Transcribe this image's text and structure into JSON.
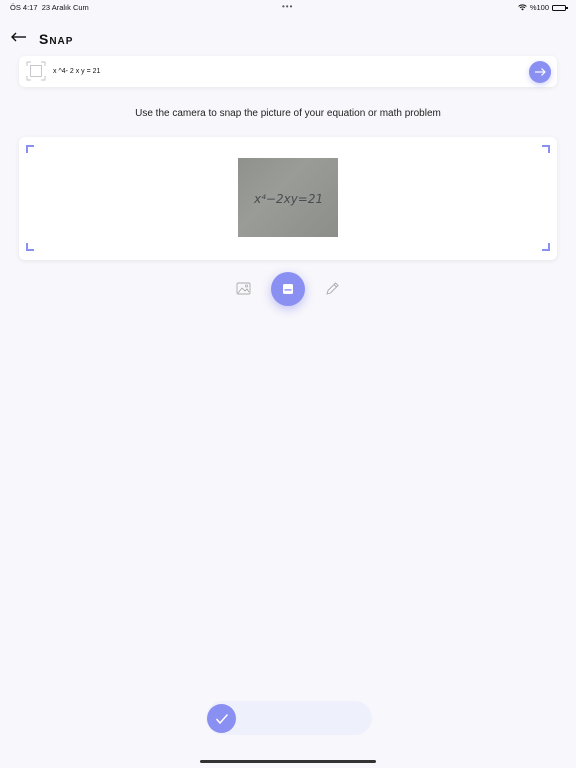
{
  "status_bar": {
    "time": "ÖS 4:17",
    "date": "23 Aralık Cum",
    "dots": "•••",
    "battery_text": "%100",
    "icons": [
      "wifi-icon",
      "battery-icon"
    ]
  },
  "header": {
    "title": "Snap",
    "back_icon": "arrow-left-icon"
  },
  "equation_bar": {
    "scan_icon": "scan-frame-icon",
    "value": "x ^4- 2 x y = 21",
    "go_icon": "arrow-right-icon"
  },
  "hint": "Use the camera to snap the picture of your equation or math problem",
  "camera_card": {
    "preview_text": "x⁴−2xy=21"
  },
  "tools": {
    "gallery_icon": "image-icon",
    "camera_icon": "camera-icon",
    "pen_icon": "pencil-icon"
  },
  "confirm": {
    "icon": "checkmark-icon"
  },
  "colors": {
    "accent": "#8a8ff2",
    "background": "#f8f7fb",
    "card": "#ffffff",
    "pill": "#eef0fb"
  }
}
